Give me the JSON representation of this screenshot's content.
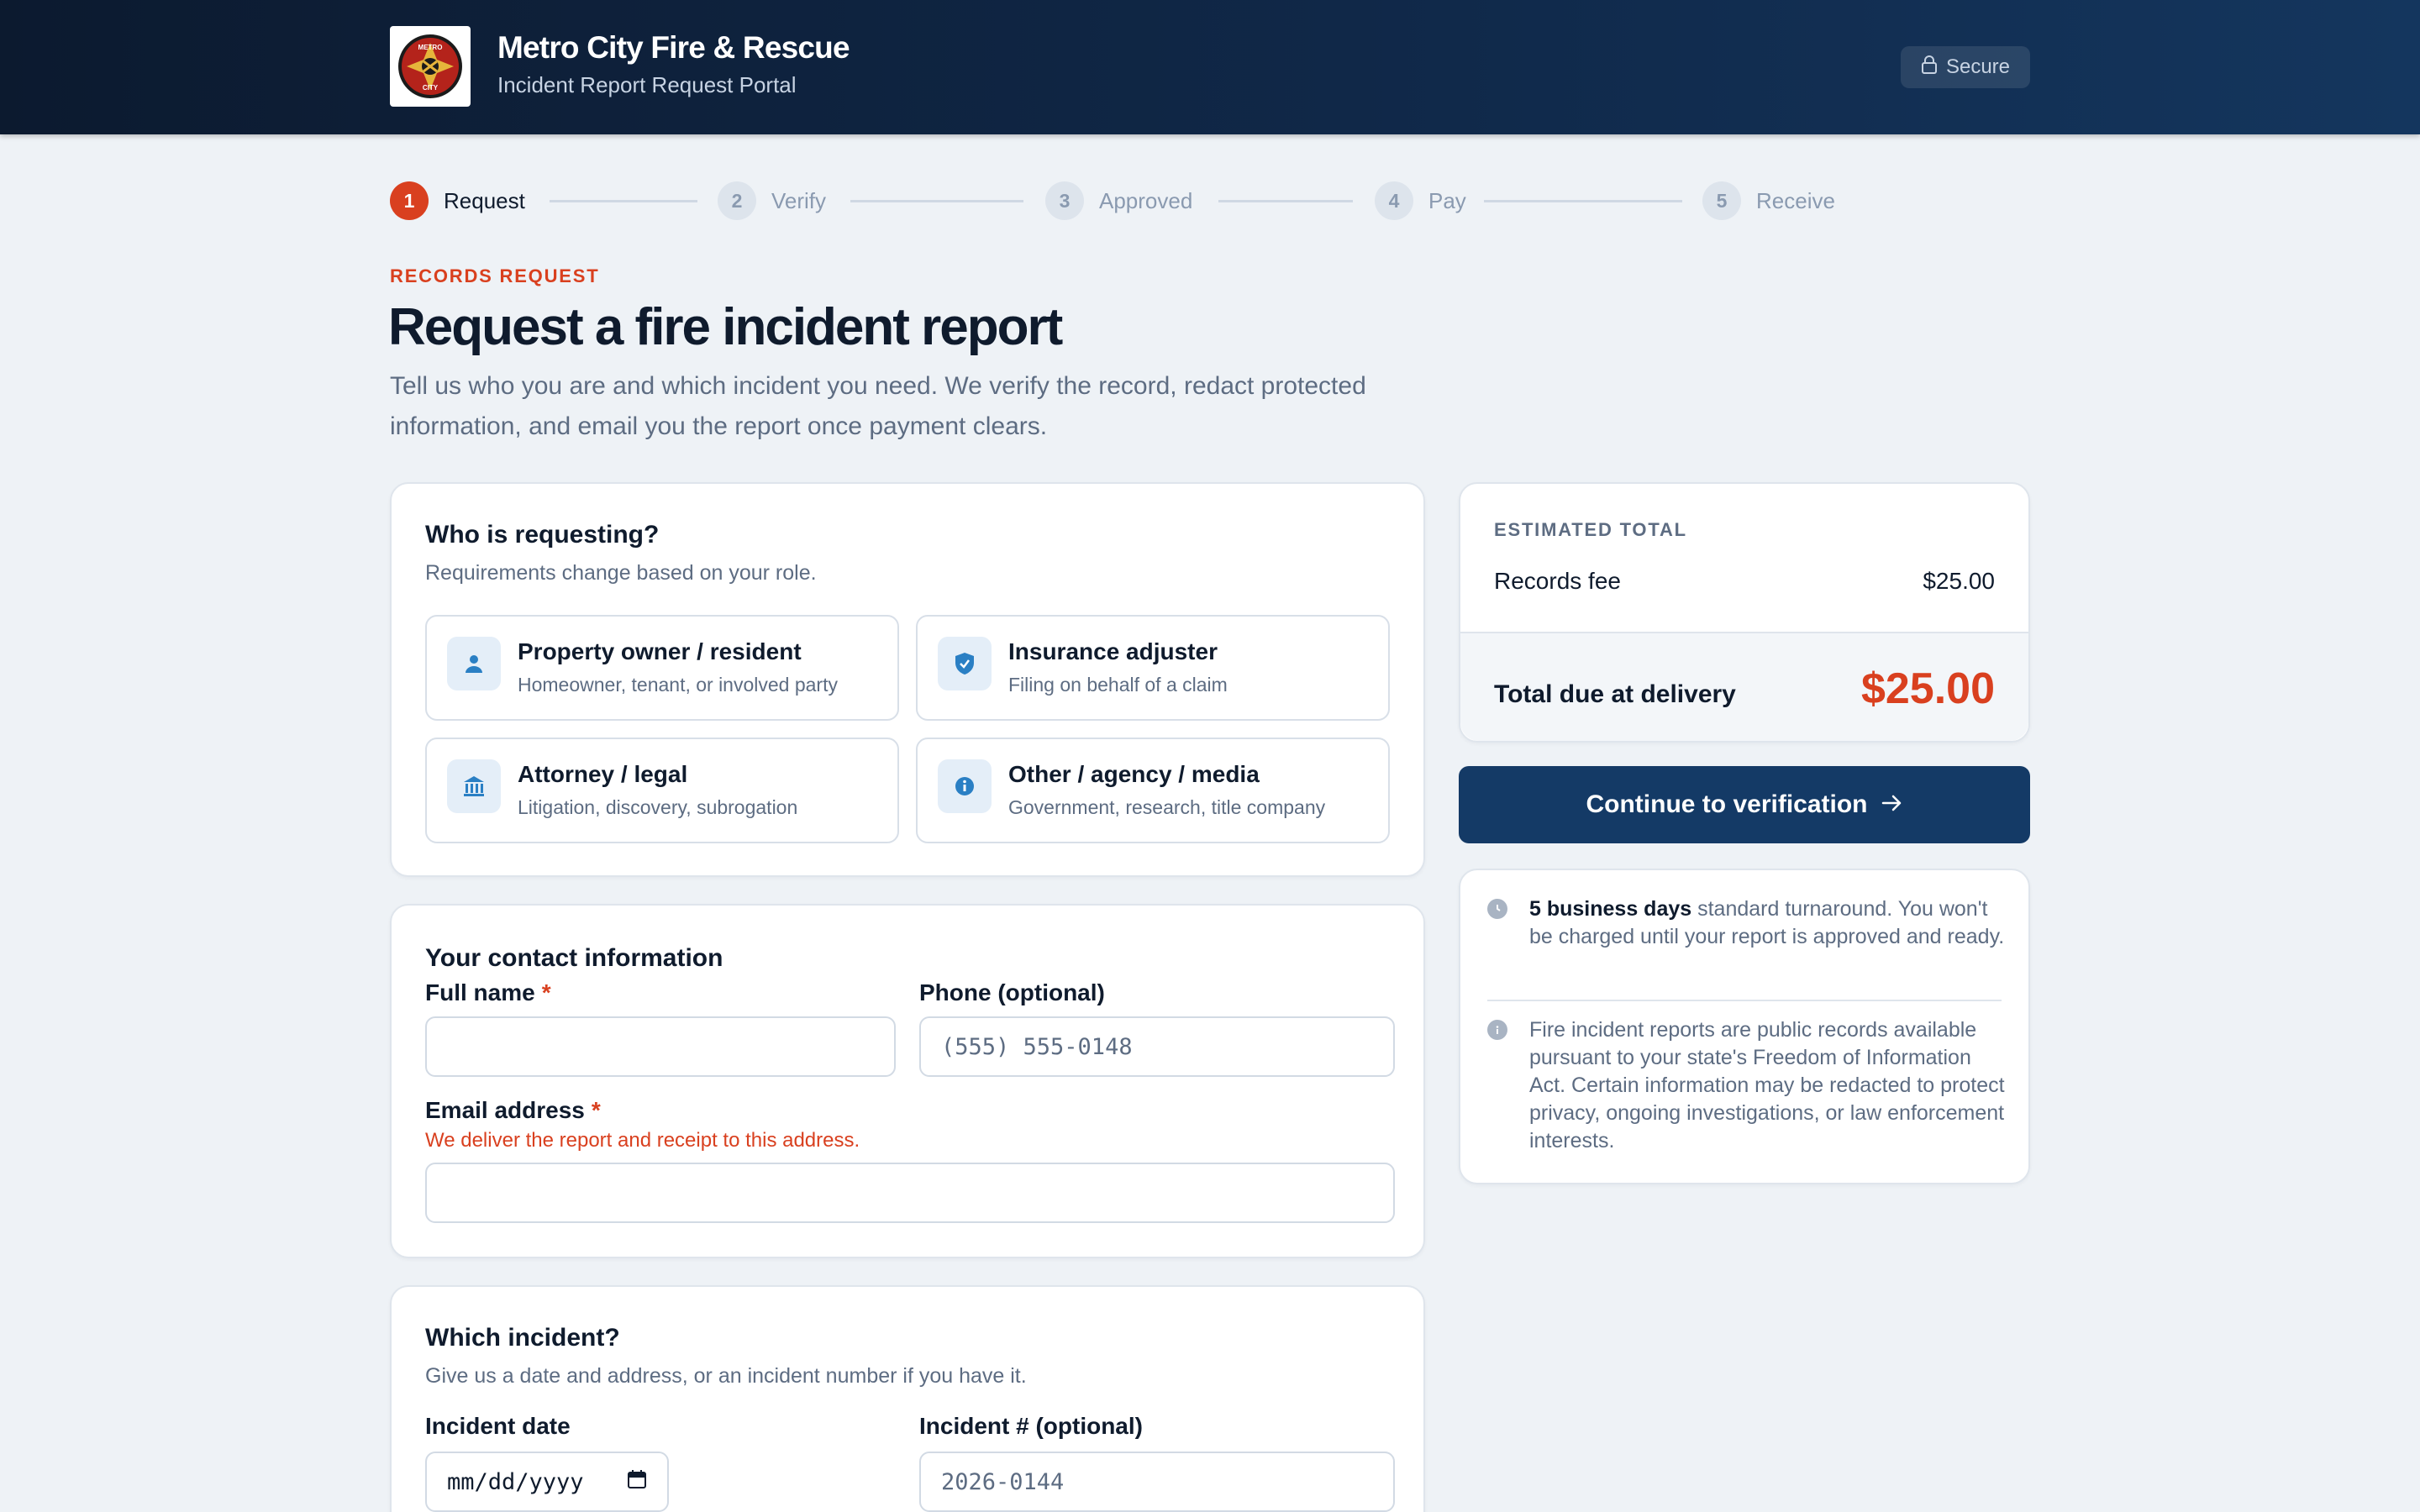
{
  "header": {
    "logo_text_top": "METRO",
    "logo_text_bottom": "CITY",
    "title": "Metro City Fire & Rescue",
    "subtitle": "Incident Report Request Portal",
    "secure_label": "Secure"
  },
  "steps": [
    {
      "num": "1",
      "label": "Request",
      "active": true
    },
    {
      "num": "2",
      "label": "Verify",
      "active": false
    },
    {
      "num": "3",
      "label": "Approved",
      "active": false
    },
    {
      "num": "4",
      "label": "Pay",
      "active": false
    },
    {
      "num": "5",
      "label": "Receive",
      "active": false
    }
  ],
  "intro": {
    "eyebrow": "RECORDS REQUEST",
    "title": "Request a fire incident report",
    "description": "Tell us who you are and which incident you need. We verify the record, redact protected information, and email you the report once payment clears."
  },
  "requester": {
    "title": "Who is requesting?",
    "subtitle": "Requirements change based on your role.",
    "roles": [
      {
        "title": "Property owner / resident",
        "desc": "Homeowner, tenant, or involved party",
        "icon": "person-icon"
      },
      {
        "title": "Insurance adjuster",
        "desc": "Filing on behalf of a claim",
        "icon": "shield-icon"
      },
      {
        "title": "Attorney / legal",
        "desc": "Litigation, discovery, subrogation",
        "icon": "building-icon"
      },
      {
        "title": "Other / agency / media",
        "desc": "Government, research, title company",
        "icon": "info-icon"
      }
    ]
  },
  "contact": {
    "title": "Your contact information",
    "full_name_label": "Full name",
    "full_name_value": "",
    "required_mark": "*",
    "phone_label": "Phone (optional)",
    "phone_placeholder": "(555) 555-0148",
    "email_label": "Email address",
    "email_hint": "We deliver the report and receipt to this address.",
    "email_value": ""
  },
  "incident": {
    "title": "Which incident?",
    "subtitle": "Give us a date and address, or an incident number if you have it.",
    "date_label": "Incident date",
    "date_placeholder": "mm/dd/yyyy",
    "number_label": "Incident # (optional)",
    "number_placeholder": "2026-0144"
  },
  "summary": {
    "label": "ESTIMATED TOTAL",
    "fee_label": "Records fee",
    "fee_value": "$25.00",
    "total_label": "Total due at delivery",
    "total_value": "$25.00"
  },
  "continue_label": "Continue to verification",
  "info": {
    "turnaround_bold": "5 business days",
    "turnaround_rest": " standard turnaround. You won't be charged until your report is approved and ready.",
    "foia_text": "Fire incident reports are public records available pursuant to your state's Freedom of Information Act. Certain information may be redacted to protect privacy, ongoing investigations, or law enforcement interests."
  },
  "colors": {
    "accent": "#d9401f",
    "navy": "#143a66",
    "header_bg": "#0c1a2f",
    "page_bg": "#eef2f6"
  }
}
